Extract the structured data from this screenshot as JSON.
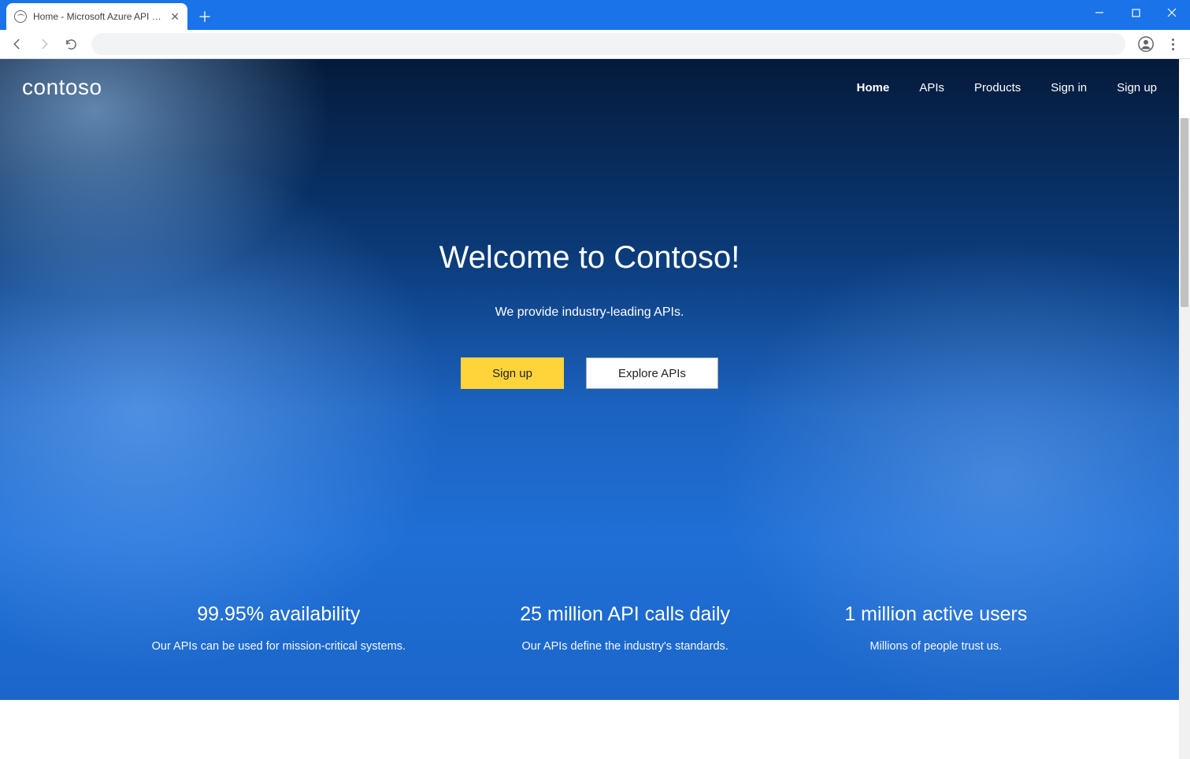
{
  "browser": {
    "tab_title": "Home - Microsoft Azure API Man"
  },
  "nav": {
    "brand": "contoso",
    "links": [
      "Home",
      "APIs",
      "Products",
      "Sign in",
      "Sign up"
    ],
    "active_index": 0
  },
  "hero": {
    "title": "Welcome to Contoso!",
    "subtitle": "We provide industry-leading APIs.",
    "cta_primary": "Sign up",
    "cta_secondary": "Explore APIs"
  },
  "stats": [
    {
      "title": "99.95% availability",
      "sub": "Our APIs can be used for mission-critical systems."
    },
    {
      "title": "25 million API calls daily",
      "sub": "Our APIs define the industry's standards."
    },
    {
      "title": "1 million active users",
      "sub": "Millions of people trust us."
    }
  ]
}
